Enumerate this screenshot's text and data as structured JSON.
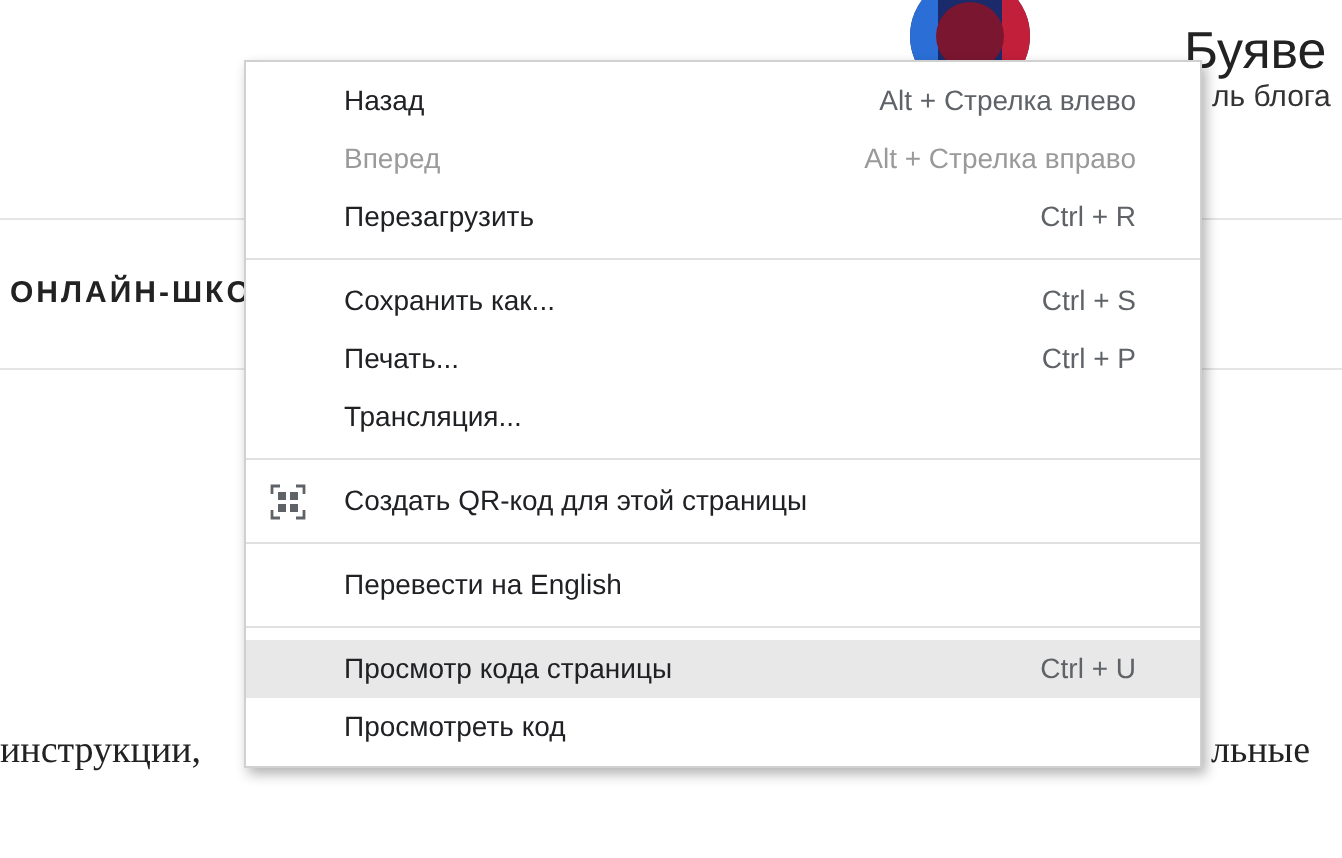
{
  "header": {
    "author_name": "Буяве",
    "author_role": "ль блога"
  },
  "nav": {
    "item": "ОНЛАЙН-ШКО"
  },
  "body": {
    "text_left": "инструкции,",
    "text_right": "льные"
  },
  "context_menu": {
    "sections": [
      {
        "items": [
          {
            "kind": "item",
            "label": "Назад",
            "shortcut": "Alt + Стрелка влево",
            "disabled": false,
            "highlighted": false
          },
          {
            "kind": "item",
            "label": "Вперед",
            "shortcut": "Alt + Стрелка вправо",
            "disabled": true,
            "highlighted": false
          },
          {
            "kind": "item",
            "label": "Перезагрузить",
            "shortcut": "Ctrl + R",
            "disabled": false,
            "highlighted": false
          }
        ]
      },
      {
        "items": [
          {
            "kind": "item",
            "label": "Сохранить как...",
            "shortcut": "Ctrl + S",
            "disabled": false,
            "highlighted": false
          },
          {
            "kind": "item",
            "label": "Печать...",
            "shortcut": "Ctrl + P",
            "disabled": false,
            "highlighted": false
          },
          {
            "kind": "item",
            "label": "Трансляция...",
            "disabled": false,
            "highlighted": false
          }
        ]
      },
      {
        "items": [
          {
            "kind": "icon-item",
            "label": "Создать QR-код для этой страницы",
            "disabled": false,
            "highlighted": false
          }
        ]
      },
      {
        "items": [
          {
            "kind": "item",
            "label": "Перевести на English",
            "disabled": false,
            "highlighted": false
          }
        ]
      },
      {
        "items": [
          {
            "kind": "item",
            "label": "Просмотр кода страницы",
            "shortcut": "Ctrl + U",
            "disabled": false,
            "highlighted": true
          },
          {
            "kind": "item",
            "label": "Просмотреть код",
            "disabled": false,
            "highlighted": false
          }
        ]
      }
    ]
  }
}
